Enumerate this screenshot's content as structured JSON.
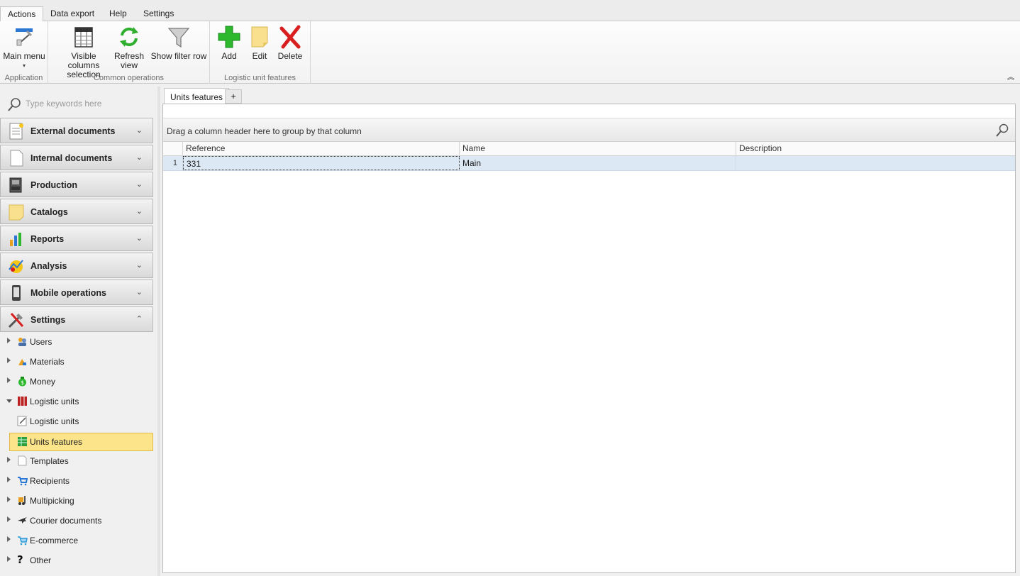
{
  "ribbon": {
    "tabs": [
      "Actions",
      "Data export",
      "Help",
      "Settings"
    ],
    "active_tab": "Actions",
    "groups": {
      "application": {
        "label": "Application",
        "main_menu": "Main menu"
      },
      "common": {
        "label": "Common operations",
        "visible_columns_l1": "Visible columns",
        "visible_columns_l2": "selection",
        "refresh_l1": "Refresh",
        "refresh_l2": "view",
        "show_filter_row": "Show filter row"
      },
      "logistic": {
        "label": "Logistic unit features",
        "add": "Add",
        "edit": "Edit",
        "delete": "Delete"
      }
    }
  },
  "nav": {
    "search_placeholder": "Type keywords here",
    "groups": [
      {
        "label": "External documents",
        "icon": "document-icon",
        "expanded": false
      },
      {
        "label": "Internal documents",
        "icon": "page-icon",
        "expanded": false
      },
      {
        "label": "Production",
        "icon": "machine-icon",
        "expanded": false
      },
      {
        "label": "Catalogs",
        "icon": "note-icon",
        "expanded": false
      },
      {
        "label": "Reports",
        "icon": "bar-chart-icon",
        "expanded": false
      },
      {
        "label": "Analysis",
        "icon": "analysis-icon",
        "expanded": false
      },
      {
        "label": "Mobile operations",
        "icon": "phone-icon",
        "expanded": false
      },
      {
        "label": "Settings",
        "icon": "tools-icon",
        "expanded": true
      }
    ],
    "settings_items": [
      {
        "label": "Users"
      },
      {
        "label": "Materials"
      },
      {
        "label": "Money"
      },
      {
        "label": "Logistic units"
      },
      {
        "label": "Logistic units"
      },
      {
        "label": "Units features"
      },
      {
        "label": "Templates"
      },
      {
        "label": "Recipients"
      },
      {
        "label": "Multipicking"
      },
      {
        "label": "Courier documents"
      },
      {
        "label": "E-commerce"
      },
      {
        "label": "Other"
      }
    ]
  },
  "main": {
    "tab_label": "Units features",
    "add_tab": "+",
    "group_panel_text": "Drag a column header here to group by that column",
    "columns": [
      "Reference",
      "Name",
      "Description"
    ],
    "rows": [
      {
        "num": "1",
        "reference": "331",
        "name": "Main",
        "description": ""
      }
    ]
  },
  "colors": {
    "selected_item_bg": "#fce48a",
    "selected_row_bg": "#dde8f5",
    "add_green": "#2db82d",
    "delete_red": "#d81e1e"
  }
}
